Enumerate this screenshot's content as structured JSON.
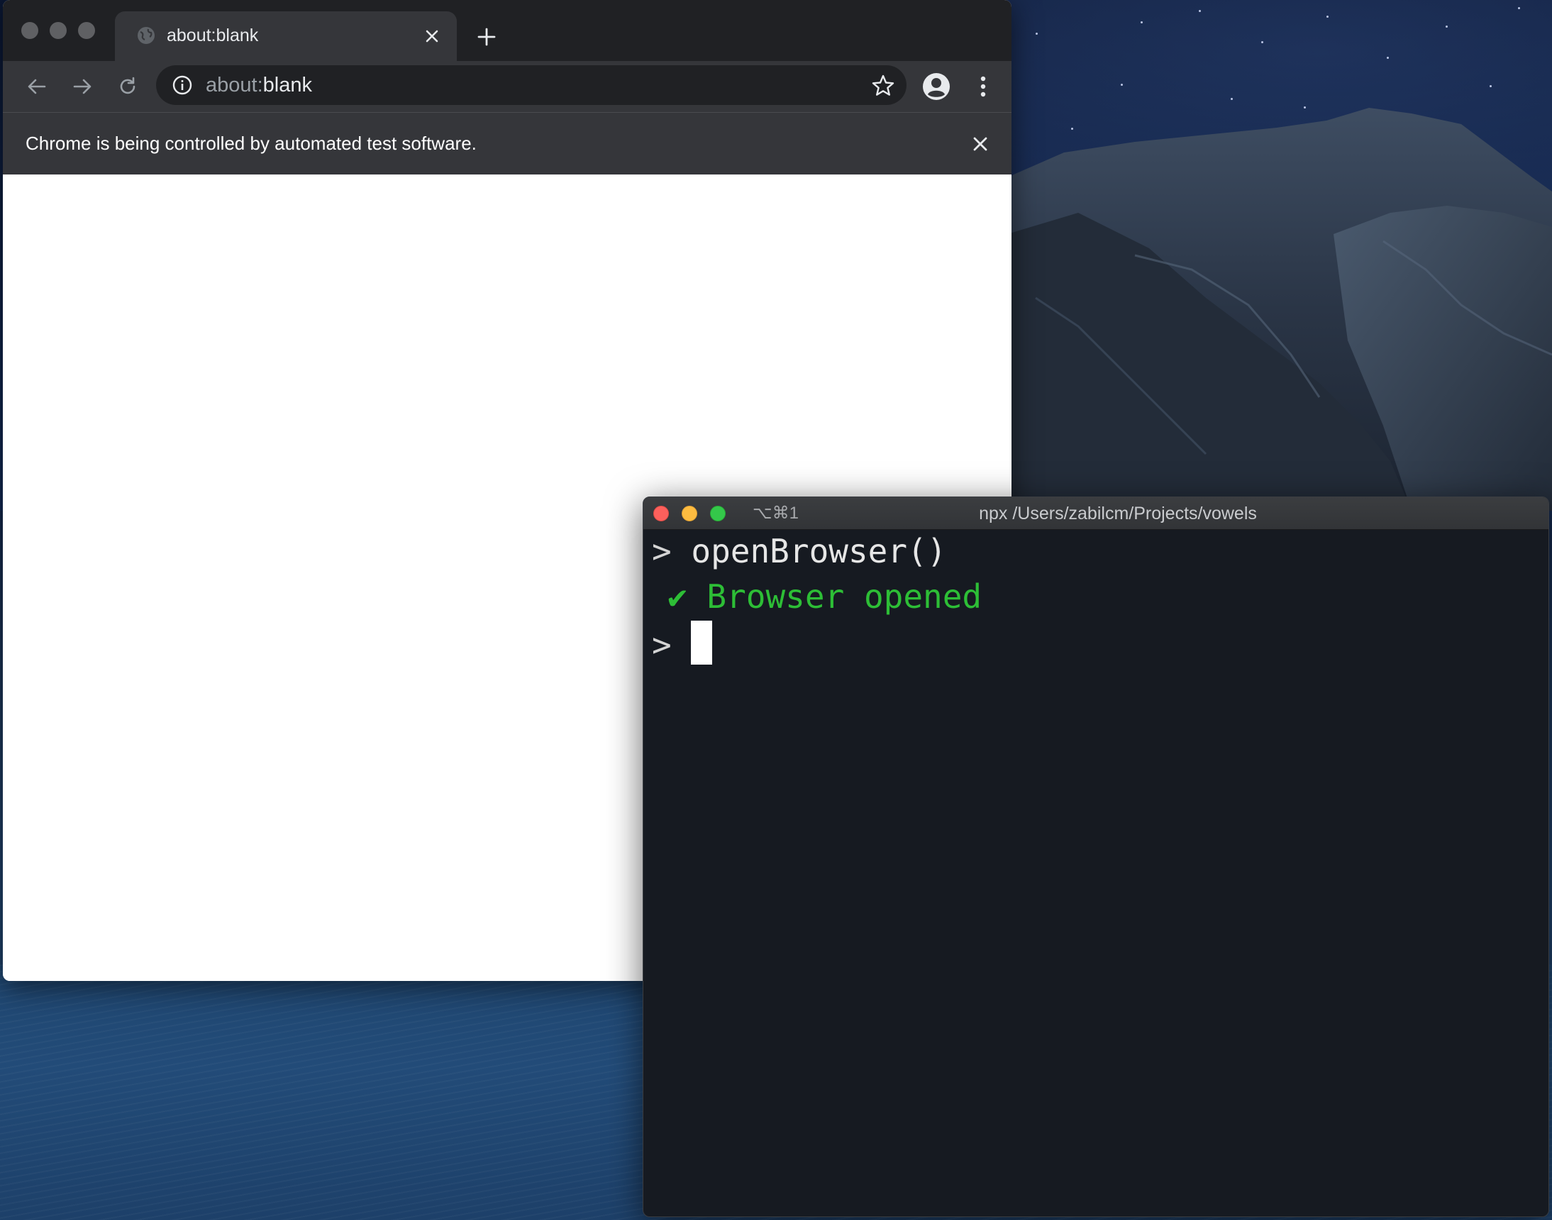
{
  "chrome": {
    "tab": {
      "title": "about:blank",
      "favicon": "globe-icon",
      "close_icon": "close-icon"
    },
    "new_tab_icon": "plus-icon",
    "toolbar": {
      "back_icon": "arrow-left-icon",
      "forward_icon": "arrow-right-icon",
      "reload_icon": "reload-icon",
      "omnibox": {
        "scheme": "about:",
        "host": "blank",
        "info_icon": "info-icon",
        "bookmark_icon": "star-icon"
      },
      "profile_icon": "account-circle-icon",
      "menu_icon": "more-vert-icon"
    },
    "infobar": {
      "message": "Chrome is being controlled by automated test software.",
      "close_icon": "close-icon"
    }
  },
  "terminal": {
    "shortcut": "⌥⌘1",
    "title": "npx /Users/zabilcm/Projects/vowels",
    "lines": {
      "prompt1": ">",
      "command1": "openBrowser()",
      "check": "✔",
      "result1": "Browser opened",
      "prompt2": ">"
    }
  },
  "colors": {
    "chrome_tabstrip": "#202124",
    "chrome_toolbar": "#35363a",
    "terminal_bg": "#161a21",
    "success_green": "#2dbe36",
    "close_red": "#fc605c",
    "minimize_yellow": "#fdbc40",
    "zoom_green": "#34c84a"
  }
}
